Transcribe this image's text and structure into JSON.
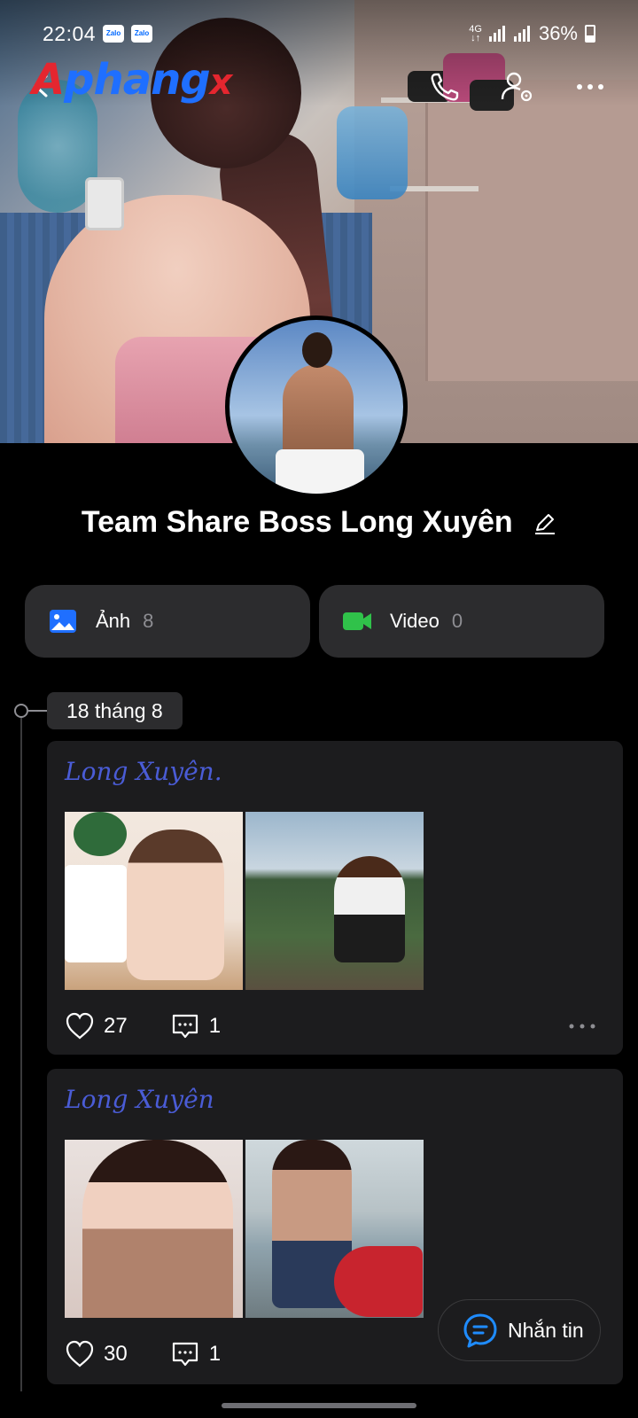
{
  "status_bar": {
    "time": "22:04",
    "notifications": [
      "Zalo",
      "Zalo"
    ],
    "network": "4G",
    "battery": "36%"
  },
  "toolbar": {
    "logo": {
      "part1": "A",
      "part2": "phang",
      "part3": "x"
    },
    "icons": [
      "back-arrow-icon",
      "phone-icon",
      "user-settings-icon",
      "more-horizontal-icon"
    ]
  },
  "profile": {
    "name": "Team Share Boss Long Xuyên"
  },
  "media": {
    "photos": {
      "label": "Ảnh",
      "count": "8"
    },
    "videos": {
      "label": "Video",
      "count": "0"
    }
  },
  "timeline": {
    "date": "18 tháng 8",
    "posts": [
      {
        "title": "Long Xuyên.",
        "likes": "27",
        "comments": "1"
      },
      {
        "title": "Long Xuyên",
        "likes": "30",
        "comments": "1"
      }
    ]
  },
  "message_button": {
    "label": "Nhắn tin"
  },
  "colors": {
    "background": "#000000",
    "card": "#1c1c1e",
    "chip": "#2c2c2e",
    "photo_icon": "#1f6fff",
    "video_icon": "#30c24a",
    "post_title": "#4a5cd6",
    "message_icon": "#1f8cff"
  }
}
